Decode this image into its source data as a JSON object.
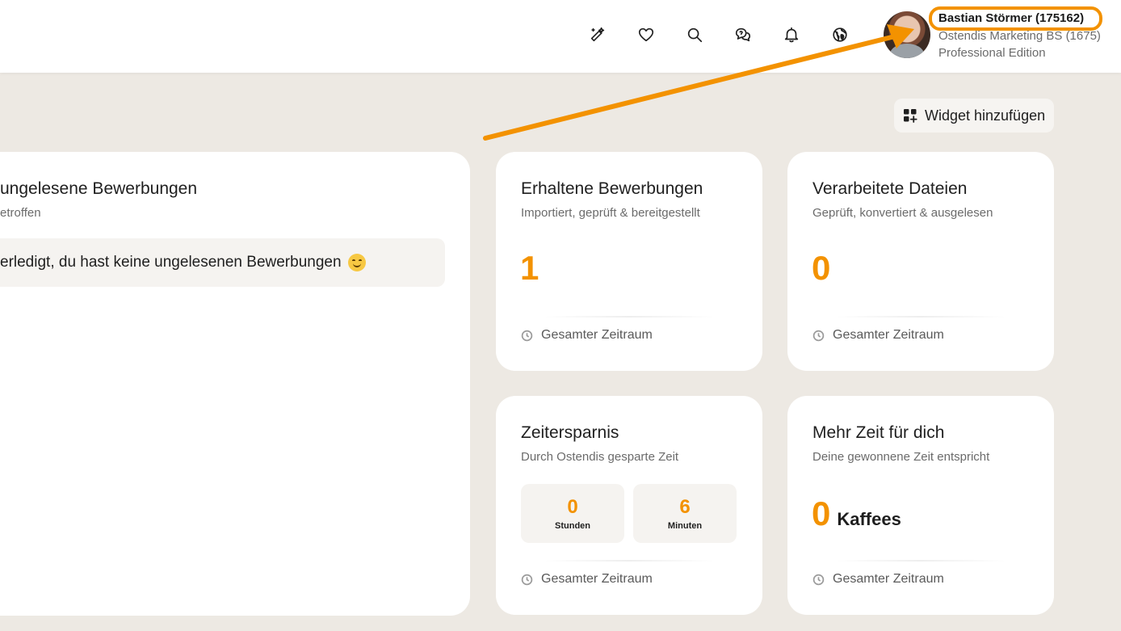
{
  "header": {
    "icons": [
      "magic-pencil-icon",
      "heart-icon",
      "search-icon",
      "chat-icon",
      "bell-icon",
      "globe-icon"
    ],
    "user": {
      "name": "Bastian Störmer (175162)",
      "organization": "Ostendis Marketing BS (1675)",
      "edition": "Professional Edition"
    }
  },
  "toolbar": {
    "add_widget_label": "Widget hinzufügen"
  },
  "widgets": {
    "unread": {
      "title": "ungelesene Bewerbungen",
      "subtitle": "etroffen",
      "message": "erledigt, du hast keine ungelesenen Bewerbungen"
    },
    "received": {
      "title": "Erhaltene Bewerbungen",
      "subtitle": "Importiert, geprüft & bereitgestellt",
      "value": "1",
      "footer": "Gesamter Zeitraum"
    },
    "processed": {
      "title": "Verarbeitete Dateien",
      "subtitle": "Geprüft, konvertiert & ausgelesen",
      "value": "0",
      "footer": "Gesamter Zeitraum"
    },
    "time_saving": {
      "title": "Zeitersparnis",
      "subtitle": "Durch Ostendis gesparte Zeit",
      "hours_value": "0",
      "hours_label": "Stunden",
      "minutes_value": "6",
      "minutes_label": "Minuten",
      "footer": "Gesamter Zeitraum"
    },
    "more_time": {
      "title": "Mehr Zeit für dich",
      "subtitle": "Deine gewonnene Zeit entspricht",
      "value": "0",
      "unit": "Kaffees",
      "footer": "Gesamter Zeitraum"
    }
  },
  "colors": {
    "accent": "#f39200",
    "background": "#ede9e3",
    "card": "#ffffff"
  }
}
